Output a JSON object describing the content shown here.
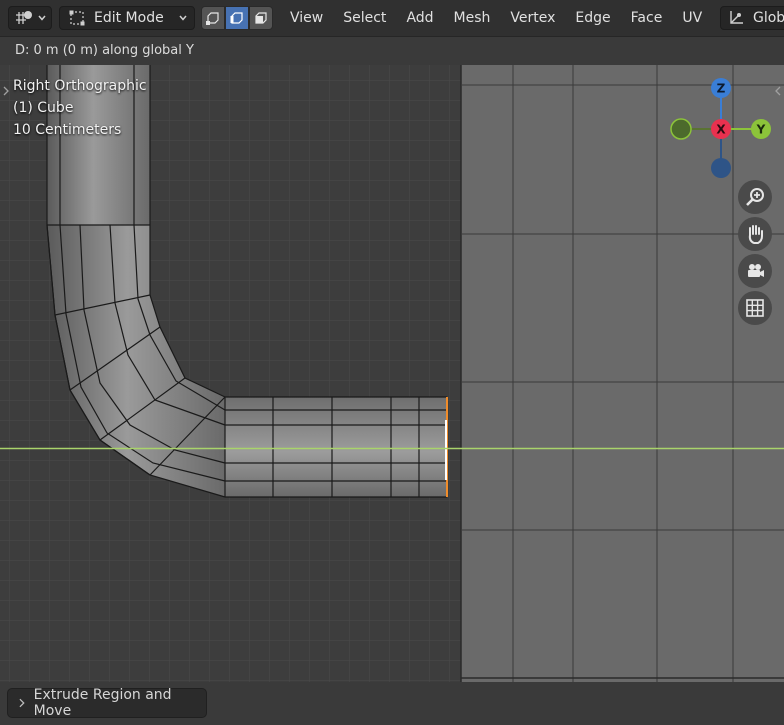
{
  "header": {
    "editor_type_icon": "viewport-icon",
    "mode_label": "Edit Mode",
    "select_modes": [
      "vertex-select-icon",
      "edge-select-icon",
      "face-select-icon"
    ],
    "active_select_mode": "edge",
    "menus": [
      "View",
      "Select",
      "Add",
      "Mesh",
      "Vertex",
      "Edge",
      "Face",
      "UV"
    ],
    "orientation_label": "Glob"
  },
  "status": {
    "text": "D: 0 m (0 m) along global Y"
  },
  "viewport": {
    "view_name": "Right Orthographic",
    "object_name": "(1) Cube",
    "grid_scale": "10 Centimeters"
  },
  "gizmo": {
    "z_label": "Z",
    "x_label": "X",
    "y_label": "Y",
    "colors": {
      "x": "#e8314f",
      "y": "#8cc43a",
      "z": "#3a7ed6",
      "neg_y": "#5a7332",
      "neg_z": "#2e5487"
    }
  },
  "nav_buttons": [
    "zoom-icon",
    "hand-pan-icon",
    "camera-icon",
    "grid-ortho-icon"
  ],
  "last_operator": {
    "label": "Extrude Region and Move"
  },
  "colors": {
    "axis_line": "#a9d46b",
    "selected_edge": "#f08c2a",
    "active_edge": "#ffffff"
  }
}
